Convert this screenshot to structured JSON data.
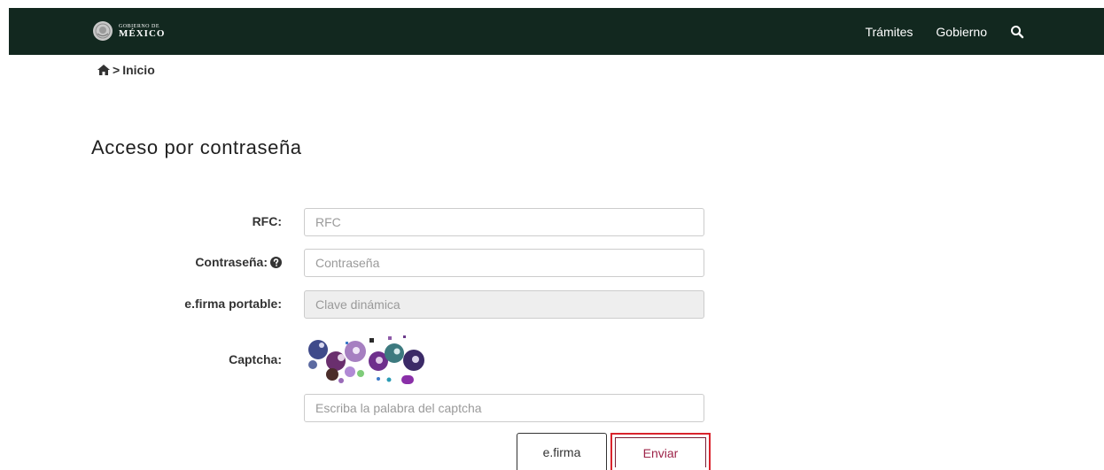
{
  "header": {
    "brand_small": "GOBIERNO DE",
    "brand_large": "MÉXICO",
    "nav": [
      "Trámites",
      "Gobierno"
    ],
    "search_icon": "search-icon",
    "background": "#12281f"
  },
  "breadcrumb": {
    "home_icon": "home-icon",
    "separator": ">",
    "current": "Inicio"
  },
  "page": {
    "title": "Acceso por contraseña"
  },
  "form": {
    "rfc_label": "RFC:",
    "rfc_placeholder": "RFC",
    "password_label": "Contraseña:",
    "password_placeholder": "Contraseña",
    "efirma_label": "e.firma portable:",
    "efirma_placeholder": "Clave dinámica",
    "captcha_label": "Captcha:",
    "captcha_placeholder": "Escriba la palabra del captcha"
  },
  "buttons": {
    "efirma": "e.firma",
    "enviar": "Enviar"
  },
  "colors": {
    "accent": "#9d2449",
    "highlight": "#d9232c"
  }
}
